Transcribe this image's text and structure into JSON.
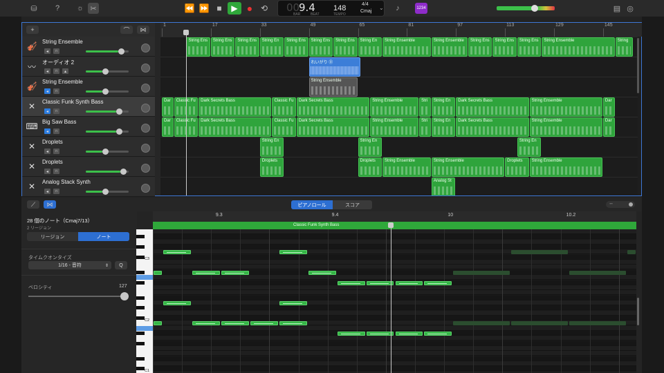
{
  "toolbar": {
    "lcd_position": "9.4",
    "lcd_position_dim": "00",
    "lcd_bar_label": "BAR",
    "lcd_beat_label": "BEAT",
    "tempo": "148",
    "tempo_label": "TEMPO",
    "time_sig": "4/4",
    "key": "Cmaj",
    "badge": "1234"
  },
  "ruler": {
    "ticks": [
      "1",
      "17",
      "33",
      "49",
      "65",
      "81",
      "97",
      "113",
      "129",
      "145"
    ]
  },
  "tracks": [
    {
      "name": "String Ensemble",
      "icon": "strings-icon",
      "icon_glyph": "🎻",
      "mute_on": false,
      "selected": false,
      "volume": 0.87
    },
    {
      "name": "オーディオ 2",
      "icon": "waveform-icon",
      "icon_glyph": "〰",
      "mute_on": false,
      "selected": false,
      "volume": 0.45
    },
    {
      "name": "String Ensemble",
      "icon": "strings-icon",
      "icon_glyph": "🎻",
      "mute_on": true,
      "selected": false,
      "volume": 0.45
    },
    {
      "name": "Classic Funk Synth Bass",
      "icon": "synth-icon",
      "icon_glyph": "✕",
      "mute_on": true,
      "selected": true,
      "volume": 0.82
    },
    {
      "name": "Big Saw Bass",
      "icon": "keyboard-synth-icon",
      "icon_glyph": "⌨",
      "mute_on": true,
      "selected": false,
      "volume": 0.82
    },
    {
      "name": "Droplets",
      "icon": "synth-icon",
      "icon_glyph": "✕",
      "mute_on": false,
      "selected": false,
      "volume": 0.45
    },
    {
      "name": "Droplets",
      "icon": "synth-icon",
      "icon_glyph": "✕",
      "mute_on": false,
      "selected": false,
      "volume": 0.92
    },
    {
      "name": "Analog Stack Synth",
      "icon": "synth-icon",
      "icon_glyph": "✕",
      "mute_on": false,
      "selected": false,
      "volume": 0.45
    }
  ],
  "regions": [
    {
      "track": 0,
      "label": "String Ens",
      "start": 9,
      "len": 8
    },
    {
      "track": 0,
      "label": "String Ens",
      "start": 17,
      "len": 8
    },
    {
      "track": 0,
      "label": "String Ens",
      "start": 25,
      "len": 8
    },
    {
      "track": 0,
      "label": "String En",
      "start": 33,
      "len": 8
    },
    {
      "track": 0,
      "label": "String Ens",
      "start": 41,
      "len": 8
    },
    {
      "track": 0,
      "label": "String Ens",
      "start": 49,
      "len": 8
    },
    {
      "track": 0,
      "label": "String Ens",
      "start": 57,
      "len": 8
    },
    {
      "track": 0,
      "label": "String En",
      "start": 65,
      "len": 8
    },
    {
      "track": 0,
      "label": "String Ensemble",
      "start": 73,
      "len": 16
    },
    {
      "track": 0,
      "label": "String Ensemble",
      "start": 89,
      "len": 12
    },
    {
      "track": 0,
      "label": "String Ens",
      "start": 101,
      "len": 8
    },
    {
      "track": 0,
      "label": "String Ens",
      "start": 109,
      "len": 8
    },
    {
      "track": 0,
      "label": "String Ens",
      "start": 117,
      "len": 8
    },
    {
      "track": 0,
      "label": "String Ensemble",
      "start": 125,
      "len": 24
    },
    {
      "track": 0,
      "label": "String",
      "start": 149,
      "len": 6
    },
    {
      "track": 1,
      "label": "れいがり ⓪",
      "start": 49,
      "len": 17,
      "kind": "audio"
    },
    {
      "track": 2,
      "label": "String Ensemble",
      "start": 49,
      "len": 16,
      "kind": "gray"
    },
    {
      "track": 3,
      "label": "Dar",
      "start": 1,
      "len": 4
    },
    {
      "track": 3,
      "label": "Classic Fu",
      "start": 5,
      "len": 8
    },
    {
      "track": 3,
      "label": "Dark Secrets Bass",
      "start": 13,
      "len": 24
    },
    {
      "track": 3,
      "label": "Classic Fu",
      "start": 37,
      "len": 8
    },
    {
      "track": 3,
      "label": "Dark Secrets Bass",
      "start": 45,
      "len": 24
    },
    {
      "track": 3,
      "label": "String Ensemble",
      "start": 69,
      "len": 16
    },
    {
      "track": 3,
      "label": "Stri",
      "start": 85,
      "len": 4
    },
    {
      "track": 3,
      "label": "String En",
      "start": 89,
      "len": 8
    },
    {
      "track": 3,
      "label": "Dark Secrets Bass",
      "start": 97,
      "len": 24
    },
    {
      "track": 3,
      "label": "String Ensemble",
      "start": 121,
      "len": 24
    },
    {
      "track": 3,
      "label": "Dar",
      "start": 145,
      "len": 4
    },
    {
      "track": 4,
      "label": "Dar",
      "start": 1,
      "len": 4
    },
    {
      "track": 4,
      "label": "Classic Fu",
      "start": 5,
      "len": 8
    },
    {
      "track": 4,
      "label": "Dark Secrets Bass",
      "start": 13,
      "len": 24
    },
    {
      "track": 4,
      "label": "Classic Fu",
      "start": 37,
      "len": 8
    },
    {
      "track": 4,
      "label": "Dark Secrets Bass",
      "start": 45,
      "len": 24
    },
    {
      "track": 4,
      "label": "String Ensemble",
      "start": 69,
      "len": 16
    },
    {
      "track": 4,
      "label": "Stri",
      "start": 85,
      "len": 4
    },
    {
      "track": 4,
      "label": "String En",
      "start": 89,
      "len": 8
    },
    {
      "track": 4,
      "label": "Dark Secrets Bass",
      "start": 97,
      "len": 24
    },
    {
      "track": 4,
      "label": "String Ensemble",
      "start": 121,
      "len": 24
    },
    {
      "track": 4,
      "label": "Dar",
      "start": 145,
      "len": 4
    },
    {
      "track": 5,
      "label": "String En",
      "start": 33,
      "len": 8
    },
    {
      "track": 5,
      "label": "String En",
      "start": 65,
      "len": 8
    },
    {
      "track": 5,
      "label": "String En",
      "start": 117,
      "len": 8
    },
    {
      "track": 6,
      "label": "Droplets",
      "start": 33,
      "len": 8
    },
    {
      "track": 6,
      "label": "Droplets",
      "start": 65,
      "len": 8
    },
    {
      "track": 6,
      "label": "String Ensemble",
      "start": 73,
      "len": 16
    },
    {
      "track": 6,
      "label": "String Ensemble",
      "start": 89,
      "len": 24
    },
    {
      "track": 6,
      "label": "Droplets",
      "start": 113,
      "len": 8
    },
    {
      "track": 6,
      "label": "String Ensemble",
      "start": 121,
      "len": 24
    },
    {
      "track": 7,
      "label": "Analog St",
      "start": 89,
      "len": 8
    }
  ],
  "editor": {
    "tab_piano_roll": "ピアノロール",
    "tab_score": "スコア",
    "inspector_title": "28 個のノート（Cmaj7/13）",
    "inspector_sub": "2 リージョン",
    "seg_region": "リージョン",
    "seg_note": "ノート",
    "quantize_label": "タイムクオンタイズ",
    "quantize_value": "1/16 - 音符",
    "quantize_button": "Q",
    "velocity_label": "ベロシティ",
    "velocity_value": "127",
    "region_name": "Classic Funk Synth Bass",
    "ruler_ticks": [
      {
        "label": "9.3",
        "pos": 0.13
      },
      {
        "label": "9.4",
        "pos": 0.37
      },
      {
        "label": "10",
        "pos": 0.61
      },
      {
        "label": "10.2",
        "pos": 0.855
      }
    ],
    "key_labels": [
      "C3",
      "C2",
      "C1"
    ],
    "notes": [
      {
        "row": 4,
        "s": 0.02,
        "e": 0.08
      },
      {
        "row": 4,
        "s": 0.26,
        "e": 0.32
      },
      {
        "row": 8,
        "s": 0.0,
        "e": 0.02
      },
      {
        "row": 8,
        "s": 0.08,
        "e": 0.14
      },
      {
        "row": 8,
        "s": 0.14,
        "e": 0.2
      },
      {
        "row": 8,
        "s": 0.32,
        "e": 0.38
      },
      {
        "row": 10,
        "s": 0.38,
        "e": 0.44
      },
      {
        "row": 10,
        "s": 0.44,
        "e": 0.5
      },
      {
        "row": 10,
        "s": 0.5,
        "e": 0.56
      },
      {
        "row": 10,
        "s": 0.56,
        "e": 0.62
      },
      {
        "row": 14,
        "s": 0.02,
        "e": 0.08
      },
      {
        "row": 14,
        "s": 0.26,
        "e": 0.32
      },
      {
        "row": 18,
        "s": 0.0,
        "e": 0.02
      },
      {
        "row": 18,
        "s": 0.08,
        "e": 0.14
      },
      {
        "row": 18,
        "s": 0.14,
        "e": 0.2
      },
      {
        "row": 18,
        "s": 0.2,
        "e": 0.26
      },
      {
        "row": 18,
        "s": 0.26,
        "e": 0.32
      },
      {
        "row": 20,
        "s": 0.38,
        "e": 0.44
      },
      {
        "row": 20,
        "s": 0.44,
        "e": 0.5
      },
      {
        "row": 20,
        "s": 0.5,
        "e": 0.56
      },
      {
        "row": 20,
        "s": 0.56,
        "e": 0.62
      },
      {
        "row": 4,
        "s": 0.74,
        "e": 0.86,
        "ghost": true
      },
      {
        "row": 4,
        "s": 0.98,
        "e": 1.0,
        "ghost": true
      },
      {
        "row": 8,
        "s": 0.62,
        "e": 0.74,
        "ghost": true
      },
      {
        "row": 8,
        "s": 0.86,
        "e": 0.98,
        "ghost": true
      },
      {
        "row": 18,
        "s": 0.62,
        "e": 0.74,
        "ghost": true
      },
      {
        "row": 18,
        "s": 0.74,
        "e": 0.86,
        "ghost": true
      },
      {
        "row": 18,
        "s": 0.86,
        "e": 0.98,
        "ghost": true
      }
    ]
  },
  "colors": {
    "region_green": "#2fa43c",
    "audio_blue": "#3c7ed8",
    "accent_blue": "#2d6fd2",
    "selection_border": "#3e78d6"
  }
}
